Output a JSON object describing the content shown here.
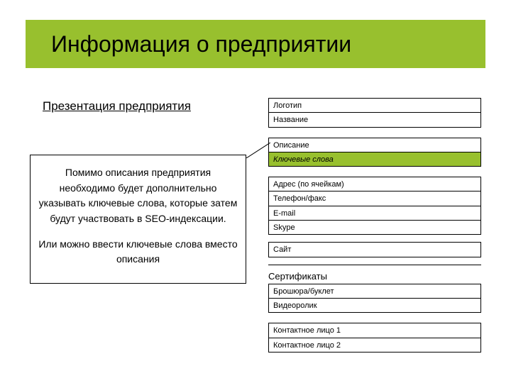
{
  "title": "Информация о предприятии",
  "subtitle": "Презентация предприятия",
  "description": {
    "p1": "Помимо описания предприятия необходимо будет дополнительно указывать ключевые слова, которые затем будут участвовать в SEO-индексации.",
    "p2": "Или можно ввести ключевые слова вместо описания"
  },
  "groups": {
    "g1": {
      "r0": "Логотип",
      "r1": "Название"
    },
    "g2": {
      "r0": "Описание",
      "r1": "Ключевые слова"
    },
    "g3": {
      "r0": "Адрес (по ячейкам)",
      "r1": "Телефон/факс",
      "r2": "E-mail",
      "r3": "Skype"
    },
    "g4": {
      "r0": "Сайт"
    },
    "certLabel": "Сертификаты",
    "g5": {
      "r0": "Брошюра/буклет",
      "r1": "Видеоролик"
    },
    "g6": {
      "r0": "Контактное лицо 1",
      "r1": "Контактное лицо 2"
    }
  }
}
